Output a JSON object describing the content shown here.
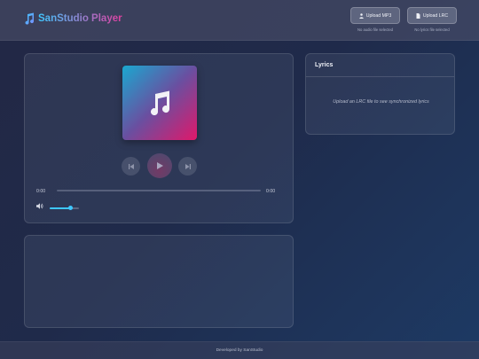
{
  "app": {
    "logo_icon": "music-note-icon",
    "title": "SanStudio Player",
    "accent_start": "#3ec7ff",
    "accent_end": "#e23ea0"
  },
  "uploads": {
    "mp3": {
      "label": "Upload MP3",
      "icon": "user-upload-icon",
      "status": "No audio file selected"
    },
    "lrc": {
      "label": "Upload LRC",
      "icon": "file-icon",
      "status": "No lyrics file selected"
    }
  },
  "player": {
    "cover_icon": "music-note-icon",
    "controls": {
      "prev_icon": "skip-back-icon",
      "play_icon": "play-icon",
      "next_icon": "skip-forward-icon"
    },
    "current_time": "0:00",
    "duration": "0:00",
    "progress": 0,
    "volume_icon": "volume-icon",
    "volume_level": 0.7
  },
  "lyrics": {
    "title": "Lyrics",
    "empty_message": "Upload an LRC file to see synchronized lyrics"
  },
  "footer": {
    "text": "Developed by SanStudio"
  }
}
